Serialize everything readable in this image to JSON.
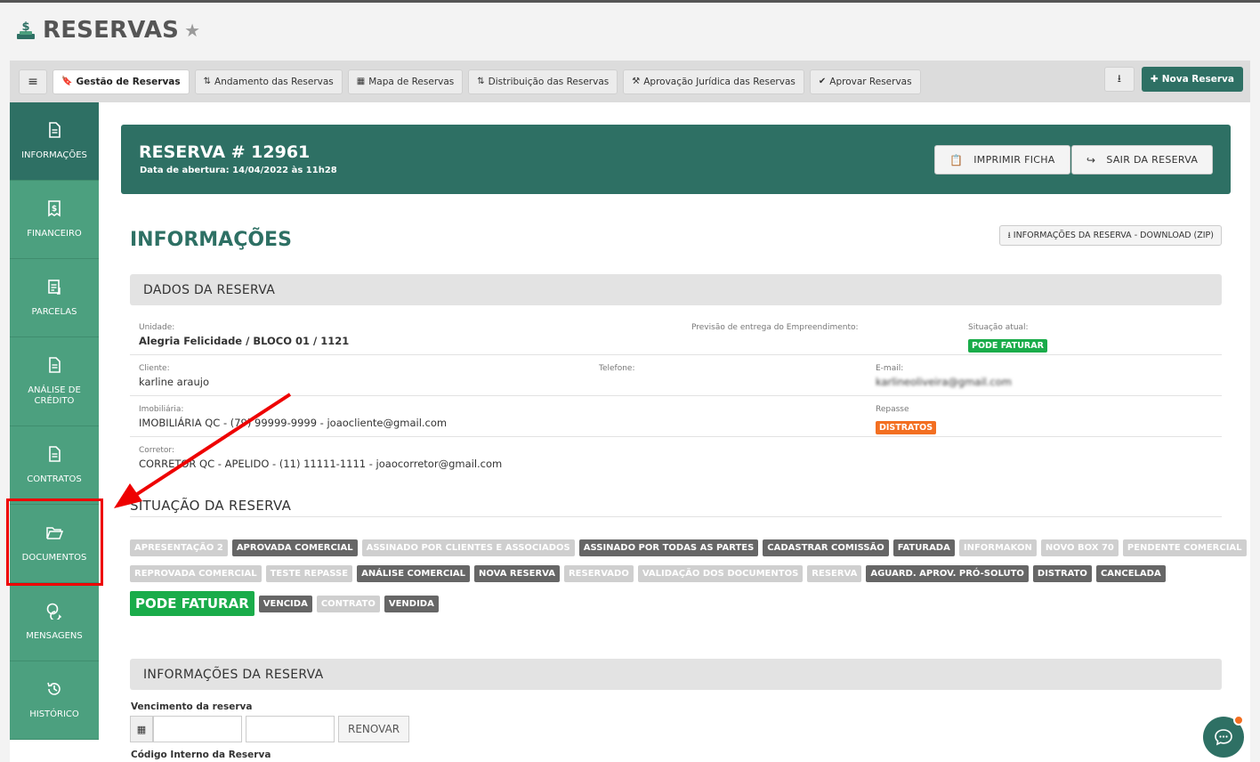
{
  "header": {
    "title": "RESERVAS"
  },
  "tabs": [
    {
      "label": "Gestão de Reservas",
      "icon": "bookmark-icon",
      "glyph": "🔖",
      "active": true
    },
    {
      "label": "Andamento das Reservas",
      "icon": "sort-icon",
      "glyph": "⇅"
    },
    {
      "label": "Mapa de Reservas",
      "icon": "map-icon",
      "glyph": "▦"
    },
    {
      "label": "Distribuição das Reservas",
      "icon": "sort-icon",
      "glyph": "⇅"
    },
    {
      "label": "Aprovação Jurídica das Reservas",
      "icon": "gavel-icon",
      "glyph": "⚒"
    },
    {
      "label": "Aprovar Reservas",
      "icon": "check-icon",
      "glyph": "✔"
    }
  ],
  "toolbar": {
    "new_label": "Nova Reserva"
  },
  "sidebar": [
    {
      "label": "INFORMAÇÕES",
      "icon": "document-icon",
      "active": true
    },
    {
      "label": "FINANCEIRO",
      "icon": "finance-icon"
    },
    {
      "label": "PARCELAS",
      "icon": "installments-icon"
    },
    {
      "label": "ANÁLISE DE CRÉDITO",
      "icon": "document-icon"
    },
    {
      "label": "CONTRATOS",
      "icon": "document-icon"
    },
    {
      "label": "DOCUMENTOS",
      "icon": "folder-open-icon"
    },
    {
      "label": "MENSAGENS",
      "icon": "chat-icon"
    },
    {
      "label": "HISTÓRICO",
      "icon": "history-icon"
    }
  ],
  "reserva": {
    "title": "RESERVA # 12961",
    "opened": "Data de abertura: 14/04/2022 às 11h28",
    "print_label": "IMPRIMIR FICHA",
    "exit_label": "SAIR DA RESERVA"
  },
  "info": {
    "section_title": "INFORMAÇÕES",
    "zip_label": "INFORMAÇÕES DA RESERVA - DOWNLOAD (ZIP)",
    "panel_title": "DADOS DA RESERVA",
    "unidade_label": "Unidade:",
    "unidade_value": "Alegria Felicidade / BLOCO 01 / 1121",
    "previsao_label": "Previsão de entrega do Empreendimento:",
    "situacao_label": "Situação atual:",
    "situacao_value": "PODE FATURAR",
    "cliente_label": "Cliente:",
    "cliente_value": "karline araujo",
    "telefone_label": "Telefone:",
    "email_label": "E-mail:",
    "email_value": "karlineoliveira@gmail.com",
    "imobiliaria_label": "Imobiliária:",
    "imobiliaria_value": "IMOBILIÁRIA QC - (79) 99999-9999 - joaocliente@gmail.com",
    "repasse_label": "Repasse",
    "repasse_value": "DISTRATOS",
    "corretor_label": "Corretor:",
    "corretor_value": "CORRETOR QC - APELIDO - (11) 11111-1111 - joaocorretor@gmail.com"
  },
  "colors": {
    "accent": "#2e7064",
    "sidebar": "#4ca07f",
    "success": "#1aac4a",
    "warning": "#f36f21",
    "highlight": "#e00000"
  },
  "situacao": {
    "title": "SITUAÇÃO DA RESERVA",
    "rows": [
      [
        {
          "label": "APRESENTAÇÃO 2",
          "style": "light"
        },
        {
          "label": "APROVADA COMERCIAL",
          "style": "dark"
        },
        {
          "label": "ASSINADO POR CLIENTES E ASSOCIADOS",
          "style": "light"
        },
        {
          "label": "ASSINADO POR TODAS AS PARTES",
          "style": "dark"
        },
        {
          "label": "CADASTRAR COMISSÃO",
          "style": "dark"
        },
        {
          "label": "FATURADA",
          "style": "dark"
        },
        {
          "label": "INFORMAKON",
          "style": "light"
        },
        {
          "label": "NOVO BOX 70",
          "style": "light"
        },
        {
          "label": "PENDENTE COMERCIAL",
          "style": "light"
        }
      ],
      [
        {
          "label": "REPROVADA COMERCIAL",
          "style": "light"
        },
        {
          "label": "TESTE REPASSE",
          "style": "light"
        },
        {
          "label": "ANÁLISE COMERCIAL",
          "style": "dark"
        },
        {
          "label": "NOVA RESERVA",
          "style": "dark"
        },
        {
          "label": "RESERVADO",
          "style": "light"
        },
        {
          "label": "VALIDAÇÃO DOS DOCUMENTOS",
          "style": "light"
        },
        {
          "label": "RESERVA",
          "style": "light"
        },
        {
          "label": "AGUARD. APROV. PRÓ-SOLUTO",
          "style": "dark"
        },
        {
          "label": "DISTRATO",
          "style": "dark"
        },
        {
          "label": "CANCELADA",
          "style": "dark"
        }
      ],
      [
        {
          "label": "PODE FATURAR",
          "style": "big"
        },
        {
          "label": "VENCIDA",
          "style": "dark"
        },
        {
          "label": "CONTRATO",
          "style": "light"
        },
        {
          "label": "VENDIDA",
          "style": "dark"
        }
      ]
    ]
  },
  "reserva_info": {
    "panel_title": "INFORMAÇÕES DA RESERVA",
    "vencimento_label": "Vencimento da reserva",
    "renovar_label": "RENOVAR",
    "codigo_label": "Código Interno da Reserva"
  }
}
